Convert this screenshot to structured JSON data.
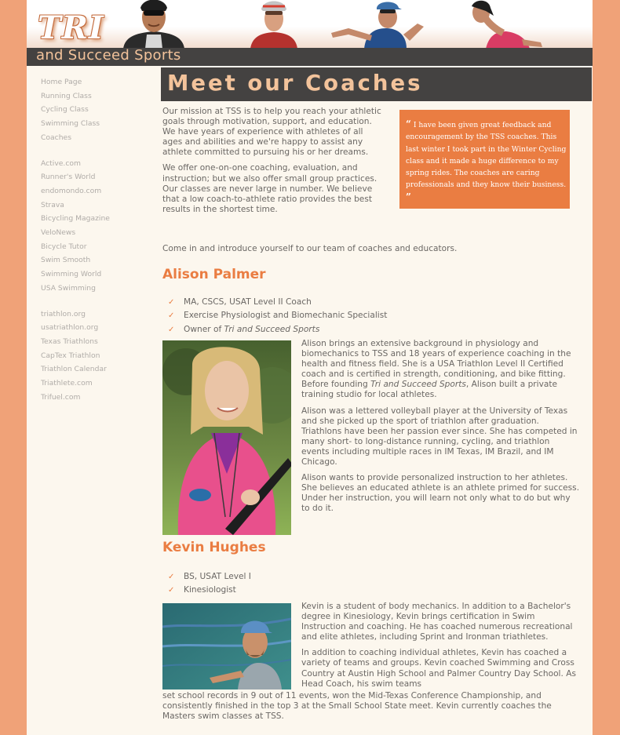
{
  "header": {
    "logo_text": "TRI",
    "tagline": "and Succeed Sports"
  },
  "sidebar": {
    "groups": [
      {
        "items": [
          "Home Page",
          "Running Class",
          "Cycling Class",
          "Swimming Class",
          "Coaches"
        ]
      },
      {
        "items": [
          "Active.com",
          "Runner's World",
          "endomondo.com",
          "Strava",
          "Bicycling Magazine",
          "VeloNews",
          "Bicycle Tutor",
          "Swim Smooth",
          "Swimming World",
          "USA Swimming"
        ]
      },
      {
        "items": [
          "triathlon.org",
          "usatriathlon.org",
          "Texas Triathlons",
          "CapTex Triathlon",
          "Triathlon Calendar",
          "Triathlete.com",
          "Trifuel.com"
        ]
      }
    ]
  },
  "page": {
    "title": "Meet our Coaches",
    "intro_p1": "Our mission at TSS is to help you reach your athletic goals through motivation, support, and education. We have years of experience with athletes of all ages and abilities and we're happy to assist any athlete committed to pursuing his or her dreams.",
    "intro_p2": "We offer one-on-one coaching, evaluation, and instruction; but we also offer small group practices. Our classes are never large in number. We believe that a low coach-to-athlete ratio provides the best results in the shortest time.",
    "come_in": "Come in and introduce yourself to our team of coaches and educators.",
    "quote": "I have been given great feedback and encouragement by the TSS coaches. This last winter I took part in the Winter Cycling class and it made a huge difference to my spring rides. The coaches are caring professionals and they know their business.",
    "quote_open": "“",
    "quote_close": "”"
  },
  "coaches": [
    {
      "name": "Alison Palmer",
      "credentials": [
        "MA, CSCS, USAT Level II Coach",
        "Exercise Physiologist and Biomechanic Specialist"
      ],
      "owner_prefix": "Owner of ",
      "owner_company": "Tri and Succeed Sports",
      "bio_p1a": "Alison brings an extensive background in physiology and biomechanics to TSS and 18 years of experience coaching in the health and fitness field. She is a USA Triathlon Level II Certified coach and is certified in strength, conditioning, and bike fitting. Before founding ",
      "bio_p1_company": "Tri and Succeed Sports",
      "bio_p1b": ", Alison built a private training studio for local athletes.",
      "bio_p2": "Alison was a lettered volleyball player at the University of Texas and she picked up the sport of triathlon after graduation. Triathlons have been her passion ever since. She has competed in many short- to long-distance running, cycling, and triathlon events including multiple races in IM Texas, IM Brazil, and IM Chicago.",
      "bio_p3": "Alison wants to provide personalized instruction to her athletes. She believes an educated athlete is an athlete primed for success. Under her instruction, you will learn not only what to do but why to do it."
    },
    {
      "name": "Kevin Hughes",
      "credentials": [
        "BS, USAT Level I",
        "Kinesiologist"
      ],
      "bio_p1": "Kevin is a student of body mechanics. In addition to a Bachelor's degree in Kinesiology, Kevin brings certification in Swim Instruction and coaching. He has coached numerous recreational and elite athletes, including Sprint and Ironman triathletes.",
      "bio_p2a": "In addition to coaching individual athletes, Kevin has coached a variety of teams and groups. Kevin coached Swimming and Cross Country at Austin High School and Palmer Country Day School. As Head Coach, his swim teams",
      "bio_p2b": "set school records in 9 out of 11 events, won the Mid-Texas Conference Championship, and consistently finished in the top 3 at the Small School State meet. Kevin currently coaches the Masters swim classes at TSS."
    }
  ],
  "icons": {
    "check": "✓"
  },
  "colors": {
    "accent": "#ea7d42",
    "page_bg": "#f0a278",
    "content_bg": "#fcf7ee",
    "bar": "#444241",
    "title_text": "#f3c39b"
  }
}
